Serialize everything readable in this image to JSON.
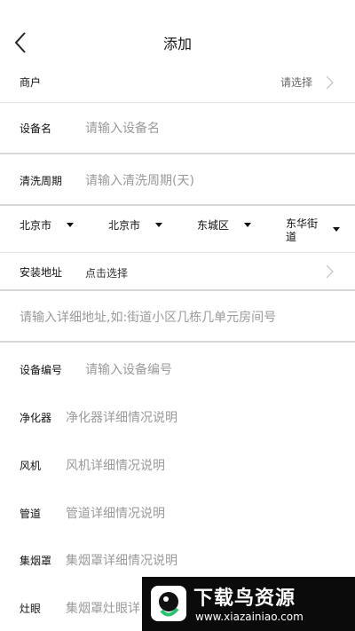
{
  "header": {
    "title": "添加",
    "back_icon": "chevron-left-icon"
  },
  "merchant": {
    "label": "商户",
    "value": "请选择"
  },
  "device_name": {
    "label": "设备名",
    "placeholder": "请输入设备名"
  },
  "cleaning_period": {
    "label": "清洗周期",
    "placeholder": "请输入清洗周期(天)"
  },
  "region": {
    "province": "北京市",
    "city": "北京市",
    "district": "东城区",
    "street": "东华街道"
  },
  "install_address": {
    "label": "安装地址",
    "value": "点击选择"
  },
  "address_detail": {
    "placeholder": "请输入详细地址,如:街道小区几栋几单元房间号"
  },
  "device_number": {
    "label": "设备编号",
    "placeholder": "请输入设备编号"
  },
  "purifier": {
    "label": "净化器",
    "placeholder": "净化器详细情况说明"
  },
  "fan": {
    "label": "风机",
    "placeholder": "风机详细情况说明"
  },
  "pipe": {
    "label": "管道",
    "placeholder": "管道详细情况说明"
  },
  "hood": {
    "label": "集烟罩",
    "placeholder": "集烟罩详细情况说明"
  },
  "stove": {
    "label": "灶眼",
    "placeholder": "集烟罩灶眼详"
  },
  "watermark": {
    "brand": "下载鸟资源",
    "url": "www.xiazainiao.com"
  }
}
